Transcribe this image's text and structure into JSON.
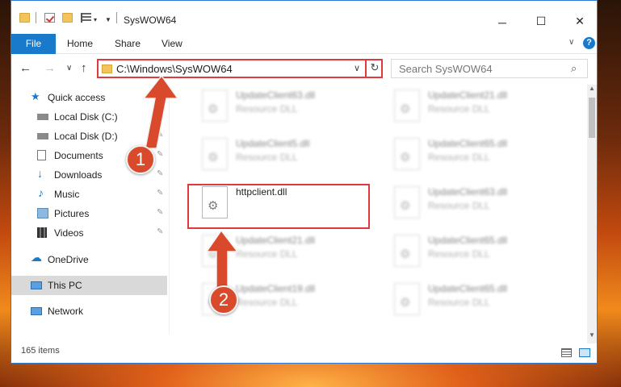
{
  "window": {
    "title": "SysWOW64",
    "buttons": {
      "minimize": "─",
      "maximize": "☐",
      "close": "✕"
    }
  },
  "ribbon": {
    "tabs": [
      {
        "label": "File",
        "active": true
      },
      {
        "label": "Home"
      },
      {
        "label": "Share"
      },
      {
        "label": "View"
      }
    ],
    "expand_glyph": "∨",
    "help_glyph": "?"
  },
  "navigation": {
    "back": "←",
    "forward": "→",
    "recent": "∨",
    "up": "↑",
    "address": "C:\\Windows\\SysWOW64",
    "address_dropdown": "∨",
    "refresh": "↻",
    "search_placeholder": "Search SysWOW64",
    "search_icon": "⌕"
  },
  "sidebar": {
    "items": [
      {
        "label": "Quick access",
        "icon": "star-icon",
        "pinned": false
      },
      {
        "label": "Local Disk (C:)",
        "icon": "drive-icon",
        "pinned": true
      },
      {
        "label": "Local Disk (D:)",
        "icon": "drive-icon",
        "pinned": true
      },
      {
        "label": "Documents",
        "icon": "documents-icon",
        "pinned": true
      },
      {
        "label": "Downloads",
        "icon": "downloads-icon",
        "pinned": true
      },
      {
        "label": "Music",
        "icon": "music-icon",
        "pinned": true
      },
      {
        "label": "Pictures",
        "icon": "pictures-icon",
        "pinned": true
      },
      {
        "label": "Videos",
        "icon": "videos-icon",
        "pinned": true
      },
      {
        "label": "OneDrive",
        "icon": "onedrive-icon",
        "pinned": false
      },
      {
        "label": "This PC",
        "icon": "pc-icon",
        "pinned": false,
        "selected": true
      },
      {
        "label": "Network",
        "icon": "network-icon",
        "pinned": false
      }
    ],
    "pin_glyph": "📌"
  },
  "files": [
    {
      "name": "UpdateClient63.dll",
      "type": "Resource DLL",
      "blurred": true
    },
    {
      "name": "UpdateClient21.dll",
      "type": "Resource DLL",
      "blurred": true
    },
    {
      "name": "UpdateClient5.dll",
      "type": "Resource DLL",
      "blurred": true
    },
    {
      "name": "UpdateClient65.dll",
      "type": "Resource DLL",
      "blurred": true
    },
    {
      "name": "httpclient.dll",
      "type": "",
      "blurred": false,
      "highlighted": true
    },
    {
      "name": "UpdateClient63.dll",
      "type": "Resource DLL",
      "blurred": true
    },
    {
      "name": "UpdateClient21.dll",
      "type": "Resource DLL",
      "blurred": true
    },
    {
      "name": "UpdateClient65.dll",
      "type": "Resource DLL",
      "blurred": true
    },
    {
      "name": "UpdateClient19.dll",
      "type": "Resource DLL",
      "blurred": true
    },
    {
      "name": "UpdateClient65.dll",
      "type": "Resource DLL",
      "blurred": true
    }
  ],
  "status": {
    "item_count": "165 items"
  },
  "callouts": {
    "one": "1",
    "two": "2"
  },
  "colors": {
    "accent": "#1979ca",
    "highlight_border": "#e0393e",
    "callout": "#d84a2b"
  }
}
